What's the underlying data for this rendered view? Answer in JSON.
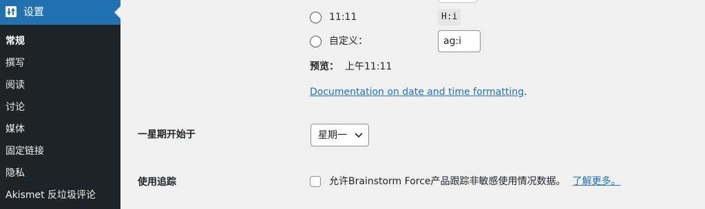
{
  "sidebar": {
    "header_label": "设置",
    "header_icon": "settings-sliders-icon",
    "items": [
      {
        "label": "常规",
        "current": true
      },
      {
        "label": "撰写"
      },
      {
        "label": "阅读"
      },
      {
        "label": "讨论"
      },
      {
        "label": "媒体"
      },
      {
        "label": "固定链接"
      },
      {
        "label": "隐私"
      },
      {
        "label": "Akismet 反垃圾评论"
      }
    ]
  },
  "time_format": {
    "option_1": {
      "label": "11:11",
      "code": "H:i"
    },
    "custom": {
      "label": "自定义：",
      "value": "ag:i"
    },
    "preview_label": "预览：",
    "preview_value": "上午11:11",
    "doc_link": "Documentation on date and time formatting",
    "doc_link_suffix": "."
  },
  "week_start": {
    "label": "一星期开始于",
    "selected": "星期一"
  },
  "usage_tracking": {
    "label": "使用追踪",
    "checkbox_text": "允许Brainstorm Force产品跟踪非敏感使用情况数据。",
    "learn_more": "了解更多。"
  },
  "colors": {
    "sidebar_bg": "#1d2327",
    "accent": "#2271b1",
    "content_bg": "#f0f0f1"
  }
}
